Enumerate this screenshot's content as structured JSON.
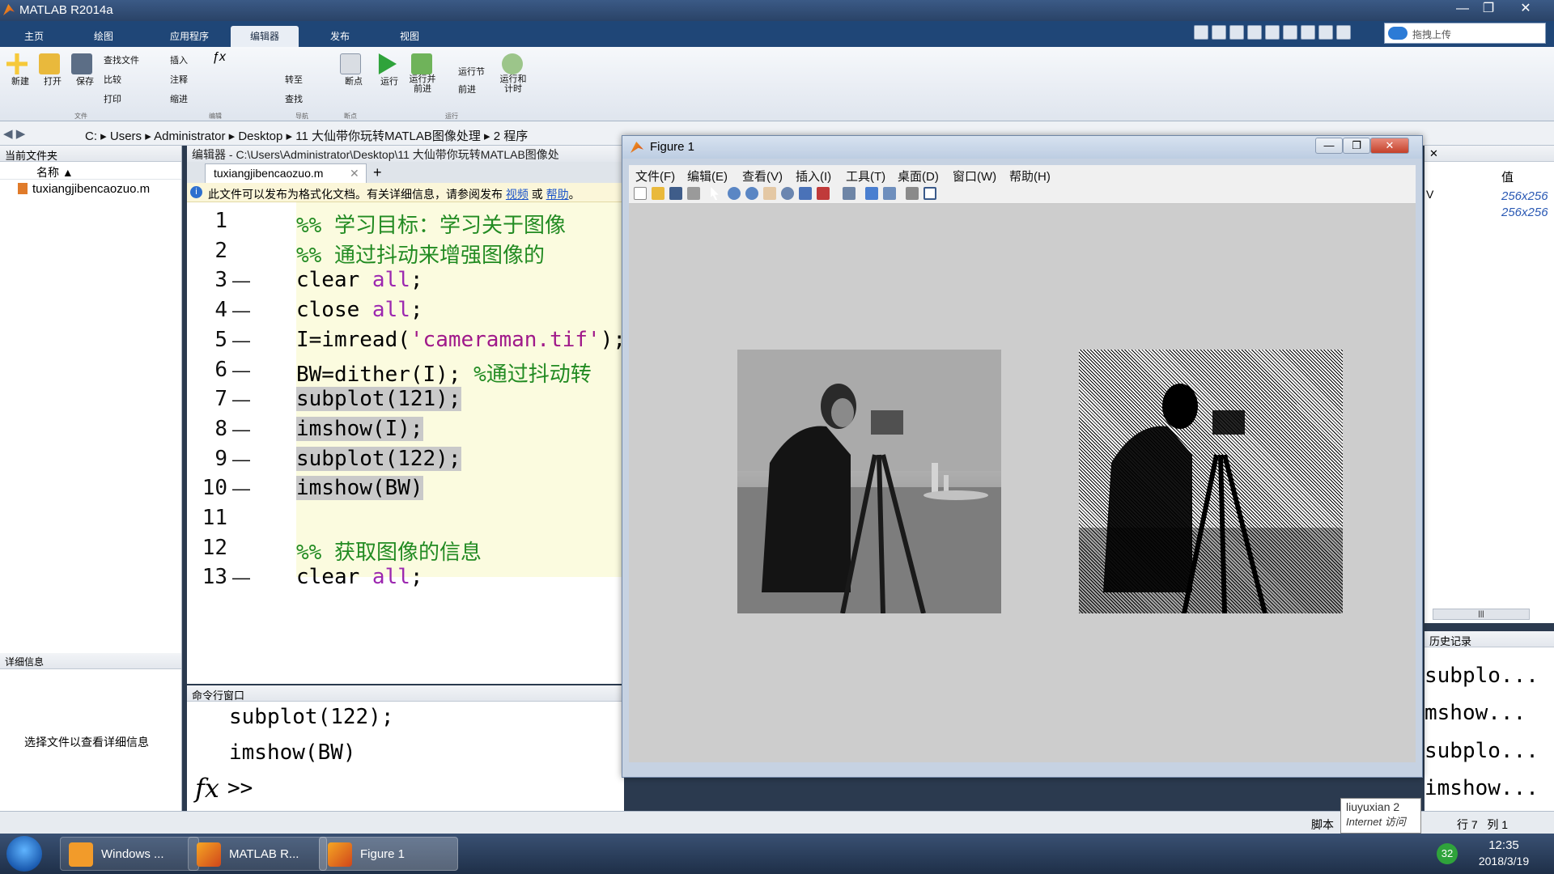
{
  "window": {
    "title": "MATLAB R2014a",
    "min": "—",
    "max": "❐",
    "close": "✕"
  },
  "ribbon_tabs": [
    "主页",
    "绘图",
    "应用程序",
    "编辑器",
    "发布",
    "视图"
  ],
  "active_tab": 3,
  "upload": {
    "label": "拖拽上传"
  },
  "ribbon": {
    "new": "新建",
    "open": "打开",
    "save": "保存",
    "find_files": "查找文件",
    "compare": "比较",
    "print": "打印",
    "insert": "插入",
    "comment": "注释",
    "indent": "缩进",
    "goto": "转至",
    "find": "查找",
    "breakpoints": "断点",
    "run": "运行",
    "run_advance": "运行并\n前进",
    "run_section": "运行节",
    "advance": "前进",
    "run_time": "运行和\n计时",
    "sections": [
      "文件",
      "编辑",
      "导航",
      "断点",
      "运行"
    ]
  },
  "address": {
    "segments": [
      "C:",
      "Users",
      "Administrator",
      "Desktop",
      "11 大仙带你玩转MATLAB图像处理",
      "2 程序"
    ]
  },
  "left_panel": {
    "title": "当前文件夹",
    "column": "名称 ▲",
    "files": [
      "tuxiangjibencaozuo.m"
    ],
    "details_title": "详细信息",
    "details_msg": "选择文件以查看详细信息"
  },
  "editor": {
    "header": "编辑器 - C:\\Users\\Administrator\\Desktop\\11 大仙带你玩转MATLAB图像处",
    "tab": "tuxiangjibencaozuo.m",
    "tab_close": "✕",
    "tab_add": "+",
    "info_text": "此文件可以发布为格式化文档。有关详细信息，请参阅发布",
    "info_link1": "视频",
    "info_or": "或",
    "info_link2": "帮助",
    "info_end": "。",
    "lines": [
      {
        "n": "1",
        "dash": "",
        "parts": [
          {
            "t": "%%  学习目标：学习关于图像",
            "c": "cm"
          }
        ],
        "hl": false
      },
      {
        "n": "2",
        "dash": "",
        "parts": [
          {
            "t": " %%  通过抖动来增强图像的",
            "c": "cm"
          }
        ],
        "hl": false
      },
      {
        "n": "3",
        "dash": "—",
        "parts": [
          {
            "t": "clear ",
            "c": ""
          },
          {
            "t": "all",
            "c": "kw"
          },
          {
            "t": ";",
            "c": ""
          }
        ],
        "hl": false
      },
      {
        "n": "4",
        "dash": "—",
        "parts": [
          {
            "t": "close ",
            "c": ""
          },
          {
            "t": "all",
            "c": "kw"
          },
          {
            "t": ";",
            "c": ""
          }
        ],
        "hl": false
      },
      {
        "n": "5",
        "dash": "—",
        "parts": [
          {
            "t": "I=imread(",
            "c": ""
          },
          {
            "t": "'cameraman.tif'",
            "c": "str"
          },
          {
            "t": ");",
            "c": ""
          }
        ],
        "hl": false
      },
      {
        "n": "6",
        "dash": "—",
        "parts": [
          {
            "t": "BW=dither(I);    ",
            "c": ""
          },
          {
            "t": "%通过抖动转",
            "c": "cm"
          }
        ],
        "hl": false
      },
      {
        "n": "7",
        "dash": "—",
        "parts": [
          {
            "t": "subplot(121);",
            "c": ""
          }
        ],
        "hl": true
      },
      {
        "n": "8",
        "dash": "—",
        "parts": [
          {
            "t": "imshow(I);",
            "c": ""
          }
        ],
        "hl": true
      },
      {
        "n": "9",
        "dash": "—",
        "parts": [
          {
            "t": "subplot(122);",
            "c": ""
          }
        ],
        "hl": true
      },
      {
        "n": "10",
        "dash": "—",
        "parts": [
          {
            "t": "imshow(BW)",
            "c": ""
          }
        ],
        "hl": true
      },
      {
        "n": "11",
        "dash": "",
        "parts": [
          {
            "t": "",
            "c": ""
          }
        ],
        "hl": false
      },
      {
        "n": "12",
        "dash": "",
        "parts": [
          {
            "t": "%%  获取图像的信息",
            "c": "cm"
          }
        ],
        "hl": false
      },
      {
        "n": "13",
        "dash": "—",
        "parts": [
          {
            "t": "clear ",
            "c": ""
          },
          {
            "t": "all",
            "c": "kw"
          },
          {
            "t": ";",
            "c": ""
          }
        ],
        "hl": false
      }
    ]
  },
  "command": {
    "title": "命令行窗口",
    "lines": [
      "subplot(122);",
      "imshow(BW)"
    ],
    "fx": "fx",
    "prompt": ">>"
  },
  "workspace": {
    "close_x": "✕",
    "col_value": "值",
    "col_short": "V",
    "values": [
      "256x256",
      "256x256"
    ],
    "scroll": "|||"
  },
  "history": {
    "title": "历史记录",
    "items": [
      "subplo...",
      "mshow...",
      "subplo...",
      "imshow..."
    ]
  },
  "figure": {
    "title": "Figure 1",
    "menu": [
      "文件(F)",
      "编辑(E)",
      "查看(V)",
      "插入(I)",
      "工具(T)",
      "桌面(D)",
      "窗口(W)",
      "帮助(H)"
    ],
    "min": "—",
    "max": "❐",
    "close": "✕"
  },
  "status": {
    "mode": "脚本",
    "row_label": "行",
    "row": "7",
    "col_label": "列",
    "col": "1"
  },
  "tooltip": {
    "name": "liuyuxian",
    "num": "2",
    "sub": "Internet 访问"
  },
  "taskbar": {
    "tasks": [
      "Windows ...",
      "MATLAB R...",
      "Figure 1"
    ],
    "active": 2,
    "time": "12:35",
    "date": "2018/3/19",
    "badge": "32"
  },
  "colors": {
    "accent": "#1f4677",
    "comment": "#228b22",
    "keyword": "#9c27b0"
  }
}
